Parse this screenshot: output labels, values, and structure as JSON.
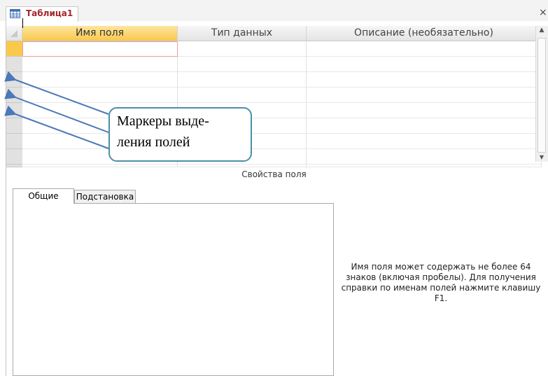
{
  "document_tab": {
    "title": "Таблица1",
    "icon": "table-icon",
    "close_label": "×"
  },
  "grid": {
    "columns": [
      "Имя поля",
      "Тип данных",
      "Описание (необязательно)"
    ],
    "row_count": 9,
    "active_row": 0
  },
  "callout": {
    "text": "Маркеры выде-ления полей"
  },
  "properties": {
    "title": "Свойства поля",
    "tabs": [
      "Общие",
      "Подстановка"
    ],
    "active_tab": "Общие",
    "help_text": "Имя поля может содержать не более 64 знаков (включая пробелы). Для получения справки по именам полей нажмите клавишу F1."
  },
  "colors": {
    "header_active": "#f8c94b",
    "tab_title": "#a4262c",
    "arrow": "#4a78b8",
    "callout_border": "#4a90a8"
  }
}
